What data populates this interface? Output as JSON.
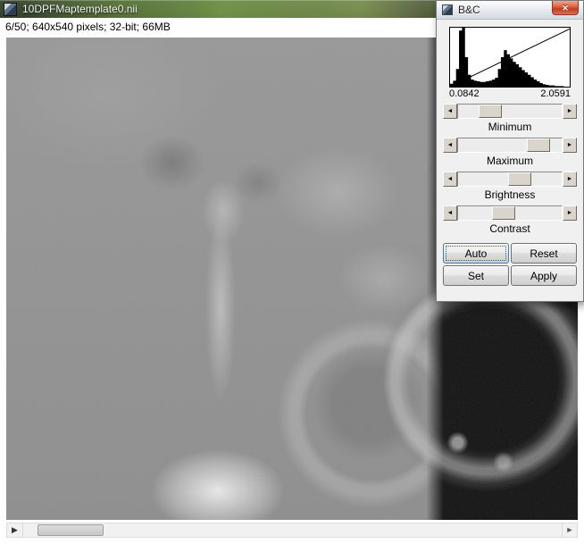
{
  "window": {
    "title": "10DPFMaptemplate0.nii",
    "info_line": "6/50; 640x540 pixels; 32-bit; 66MB"
  },
  "stack_scrollbar": {
    "position_pct": 3
  },
  "icons": {
    "play": "▶",
    "slider_left": "◄",
    "slider_right": "►",
    "close": "✕"
  },
  "bc_dialog": {
    "title": "B&C",
    "histogram": {
      "min_label": "0.0842",
      "max_label": "2.0591",
      "bars": [
        0.05,
        0.1,
        0.3,
        0.95,
        1.0,
        0.5,
        0.2,
        0.12,
        0.1,
        0.09,
        0.08,
        0.08,
        0.09,
        0.1,
        0.12,
        0.15,
        0.3,
        0.5,
        0.62,
        0.55,
        0.48,
        0.42,
        0.38,
        0.33,
        0.28,
        0.24,
        0.2,
        0.16,
        0.12,
        0.09,
        0.06,
        0.04,
        0.03,
        0.02,
        0.02,
        0.01,
        0.01,
        0.01,
        0.0,
        0.0
      ]
    },
    "sliders": [
      {
        "label": "Minimum",
        "position_pct": 25
      },
      {
        "label": "Maximum",
        "position_pct": 85
      },
      {
        "label": "Brightness",
        "position_pct": 62
      },
      {
        "label": "Contrast",
        "position_pct": 42
      }
    ],
    "buttons": [
      {
        "label": "Auto"
      },
      {
        "label": "Reset"
      },
      {
        "label": "Set"
      },
      {
        "label": "Apply"
      }
    ]
  }
}
